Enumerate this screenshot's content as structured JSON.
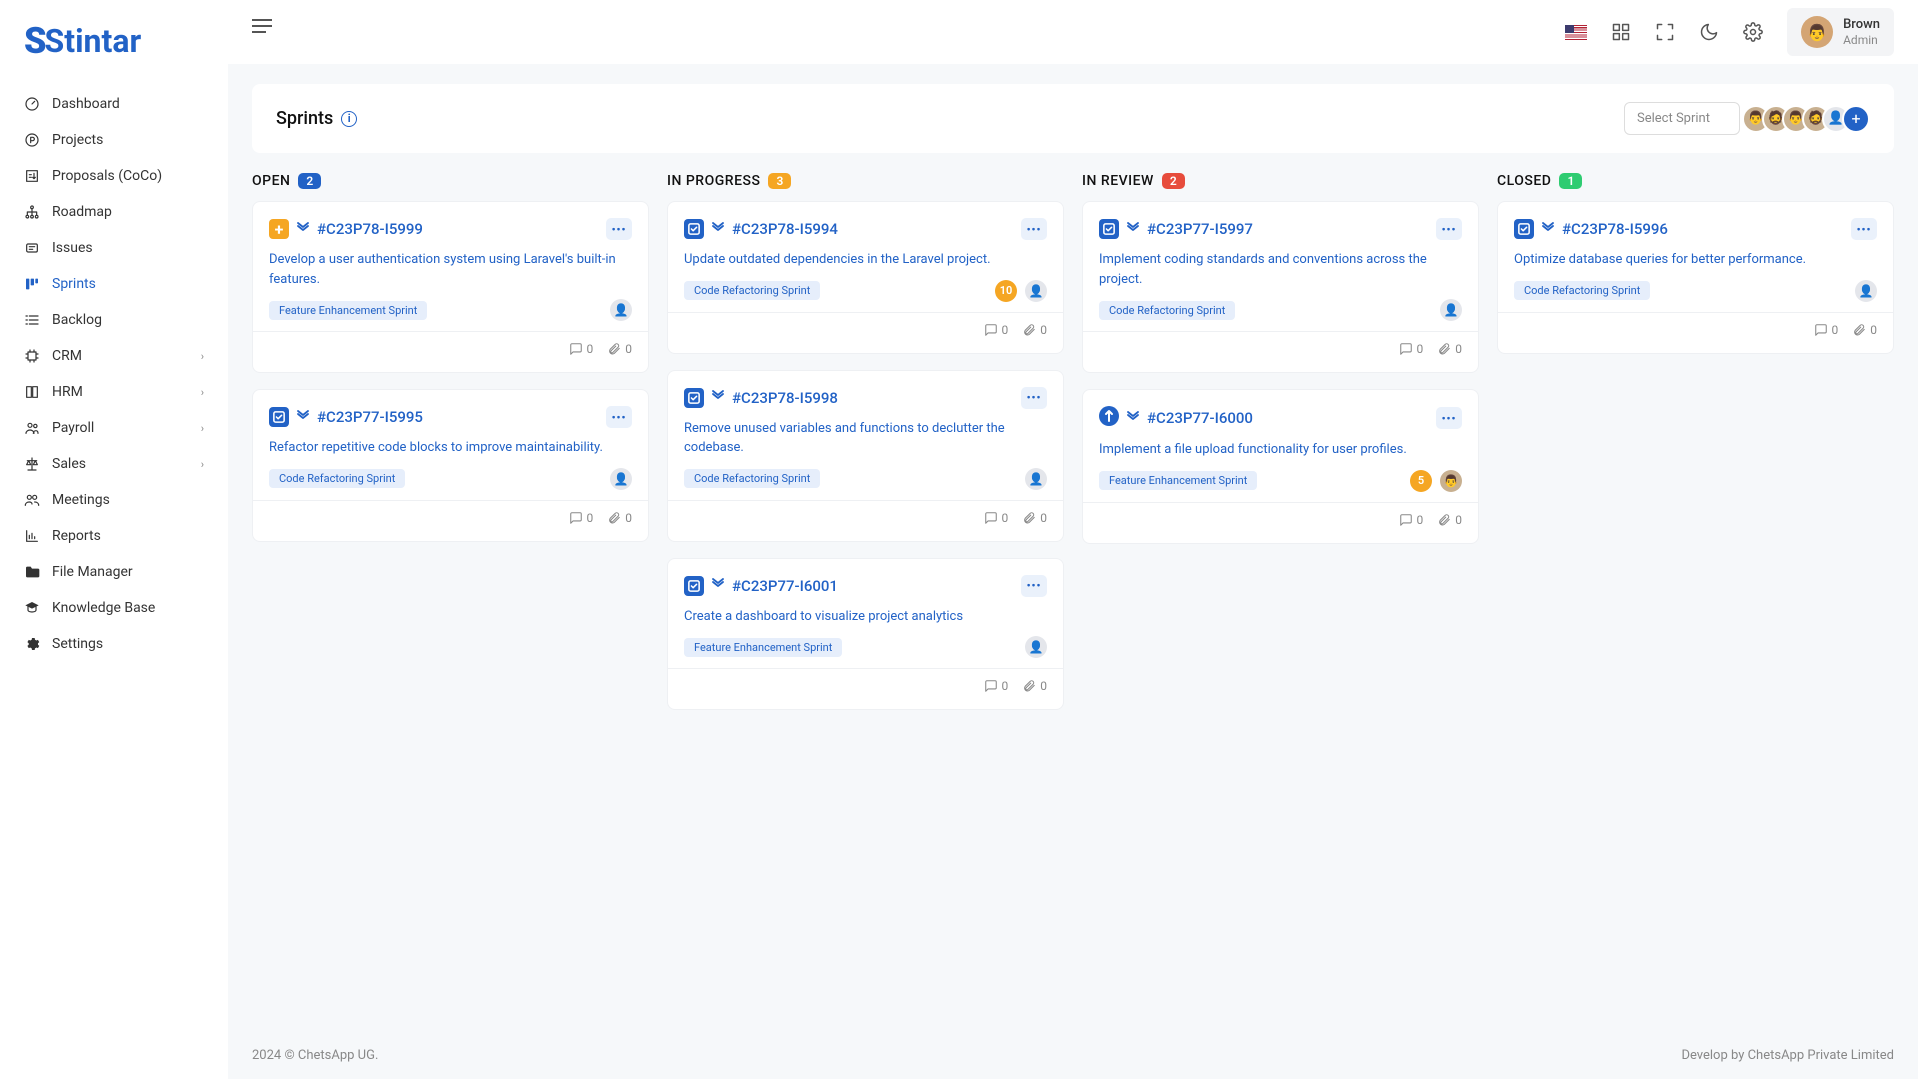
{
  "app": {
    "logo": "Stintar"
  },
  "nav": [
    {
      "label": "Dashboard",
      "icon": "gauge"
    },
    {
      "label": "Projects",
      "icon": "circle-p"
    },
    {
      "label": "Proposals (CoCo)",
      "icon": "proposal"
    },
    {
      "label": "Roadmap",
      "icon": "org"
    },
    {
      "label": "Issues",
      "icon": "bug"
    },
    {
      "label": "Sprints",
      "icon": "board",
      "active": true
    },
    {
      "label": "Backlog",
      "icon": "list"
    },
    {
      "label": "CRM",
      "icon": "chip",
      "expand": true
    },
    {
      "label": "HRM",
      "icon": "book",
      "expand": true
    },
    {
      "label": "Payroll",
      "icon": "people",
      "expand": true
    },
    {
      "label": "Sales",
      "icon": "scale",
      "expand": true
    },
    {
      "label": "Meetings",
      "icon": "users"
    },
    {
      "label": "Reports",
      "icon": "chart"
    },
    {
      "label": "File Manager",
      "icon": "folder"
    },
    {
      "label": "Knowledge Base",
      "icon": "grad"
    },
    {
      "label": "Settings",
      "icon": "gear"
    }
  ],
  "user": {
    "name": "Brown",
    "role": "Admin"
  },
  "page": {
    "title": "Sprints",
    "select_label": "Select Sprint"
  },
  "columns": [
    {
      "title": "OPEN",
      "count": "2",
      "color": "bg-blue",
      "cards": [
        {
          "id": "#C23P78-I5999",
          "type": "feat",
          "title": "Develop a user authentication system using Laravel's built-in features.",
          "chip": "Feature Enhancement Sprint",
          "comments": "0",
          "att": "0"
        },
        {
          "id": "#C23P77-I5995",
          "type": "task",
          "title": "Refactor repetitive code blocks to improve maintainability.",
          "chip": "Code Refactoring Sprint",
          "comments": "0",
          "att": "0"
        }
      ]
    },
    {
      "title": "IN PROGRESS",
      "count": "3",
      "color": "bg-yellow",
      "cards": [
        {
          "id": "#C23P78-I5994",
          "type": "task",
          "title": "Update outdated dependencies in the Laravel project.",
          "chip": "Code Refactoring Sprint",
          "points": "10",
          "comments": "0",
          "att": "0"
        },
        {
          "id": "#C23P78-I5998",
          "type": "task",
          "title": "Remove unused variables and functions to declutter the codebase.",
          "chip": "Code Refactoring Sprint",
          "comments": "0",
          "att": "0"
        },
        {
          "id": "#C23P77-I6001",
          "type": "task",
          "title": "Create a dashboard to visualize project analytics",
          "chip": "Feature Enhancement Sprint",
          "comments": "0",
          "att": "0"
        }
      ]
    },
    {
      "title": "IN REVIEW",
      "count": "2",
      "color": "bg-red",
      "cards": [
        {
          "id": "#C23P77-I5997",
          "type": "task",
          "title": "Implement coding standards and conventions across the project.",
          "chip": "Code Refactoring Sprint",
          "comments": "0",
          "att": "0"
        },
        {
          "id": "#C23P77-I6000",
          "type": "feat-circle",
          "title": "Implement a file upload functionality for user profiles.",
          "chip": "Feature Enhancement Sprint",
          "points": "5",
          "avatar": true,
          "comments": "0",
          "att": "0"
        }
      ]
    },
    {
      "title": "CLOSED",
      "count": "1",
      "color": "bg-green",
      "cards": [
        {
          "id": "#C23P78-I5996",
          "type": "task",
          "title": "Optimize database queries for better performance.",
          "chip": "Code Refactoring Sprint",
          "comments": "0",
          "att": "0"
        }
      ]
    }
  ],
  "footer": {
    "left": "2024 © ChetsApp UG.",
    "right": "Develop by ChetsApp Private Limited"
  }
}
